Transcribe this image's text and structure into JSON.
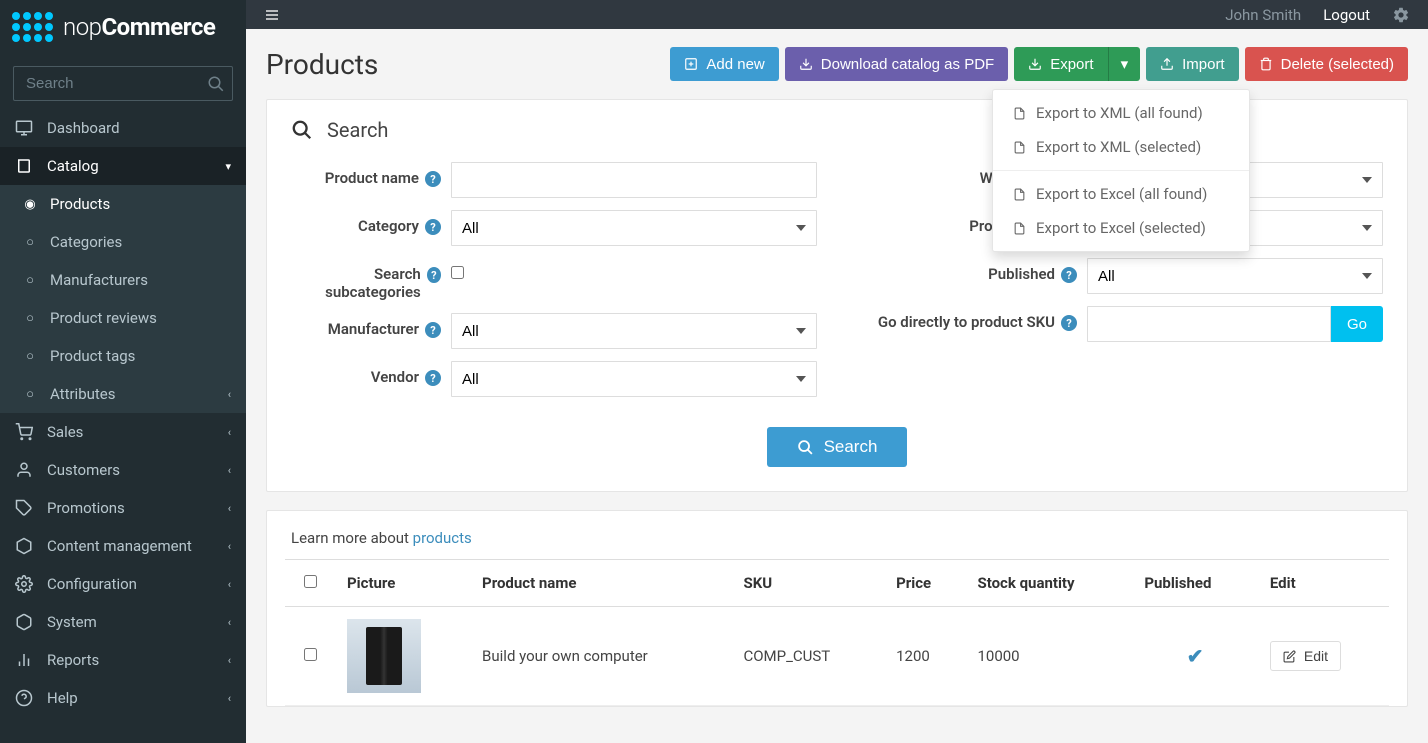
{
  "brand": {
    "name_prefix": "nop",
    "name_bold": "Commerce"
  },
  "search": {
    "placeholder": "Search"
  },
  "topbar": {
    "user": "John Smith",
    "logout": "Logout"
  },
  "nav": {
    "dashboard": "Dashboard",
    "catalog": "Catalog",
    "catalog_children": {
      "products": "Products",
      "categories": "Categories",
      "manufacturers": "Manufacturers",
      "product_reviews": "Product reviews",
      "product_tags": "Product tags",
      "attributes": "Attributes"
    },
    "sales": "Sales",
    "customers": "Customers",
    "promotions": "Promotions",
    "content": "Content management",
    "configuration": "Configuration",
    "system": "System",
    "reports": "Reports",
    "help": "Help"
  },
  "page": {
    "title": "Products",
    "actions": {
      "add_new": "Add new",
      "download_pdf": "Download catalog as PDF",
      "export": "Export",
      "import": "Import",
      "delete_selected": "Delete (selected)"
    },
    "export_menu": {
      "xml_all": "Export to XML (all found)",
      "xml_sel": "Export to XML (selected)",
      "excel_all": "Export to Excel (all found)",
      "excel_sel": "Export to Excel (selected)"
    }
  },
  "search_panel": {
    "heading": "Search",
    "labels": {
      "product_name": "Product name",
      "category": "Category",
      "search_subcat": "Search subcategories",
      "manufacturer": "Manufacturer",
      "vendor": "Vendor",
      "warehouse": "Warehouse",
      "product_type": "Product type",
      "published": "Published",
      "sku": "Go directly to product SKU"
    },
    "all": "All",
    "go": "Go",
    "search_btn": "Search"
  },
  "learn_more": {
    "text": "Learn more about ",
    "link": "products"
  },
  "table": {
    "headers": {
      "picture": "Picture",
      "name": "Product name",
      "sku": "SKU",
      "price": "Price",
      "stock": "Stock quantity",
      "published": "Published",
      "edit": "Edit"
    },
    "rows": [
      {
        "name": "Build your own computer",
        "sku": "COMP_CUST",
        "price": "1200",
        "stock": "10000",
        "published": true,
        "edit": "Edit"
      }
    ]
  }
}
